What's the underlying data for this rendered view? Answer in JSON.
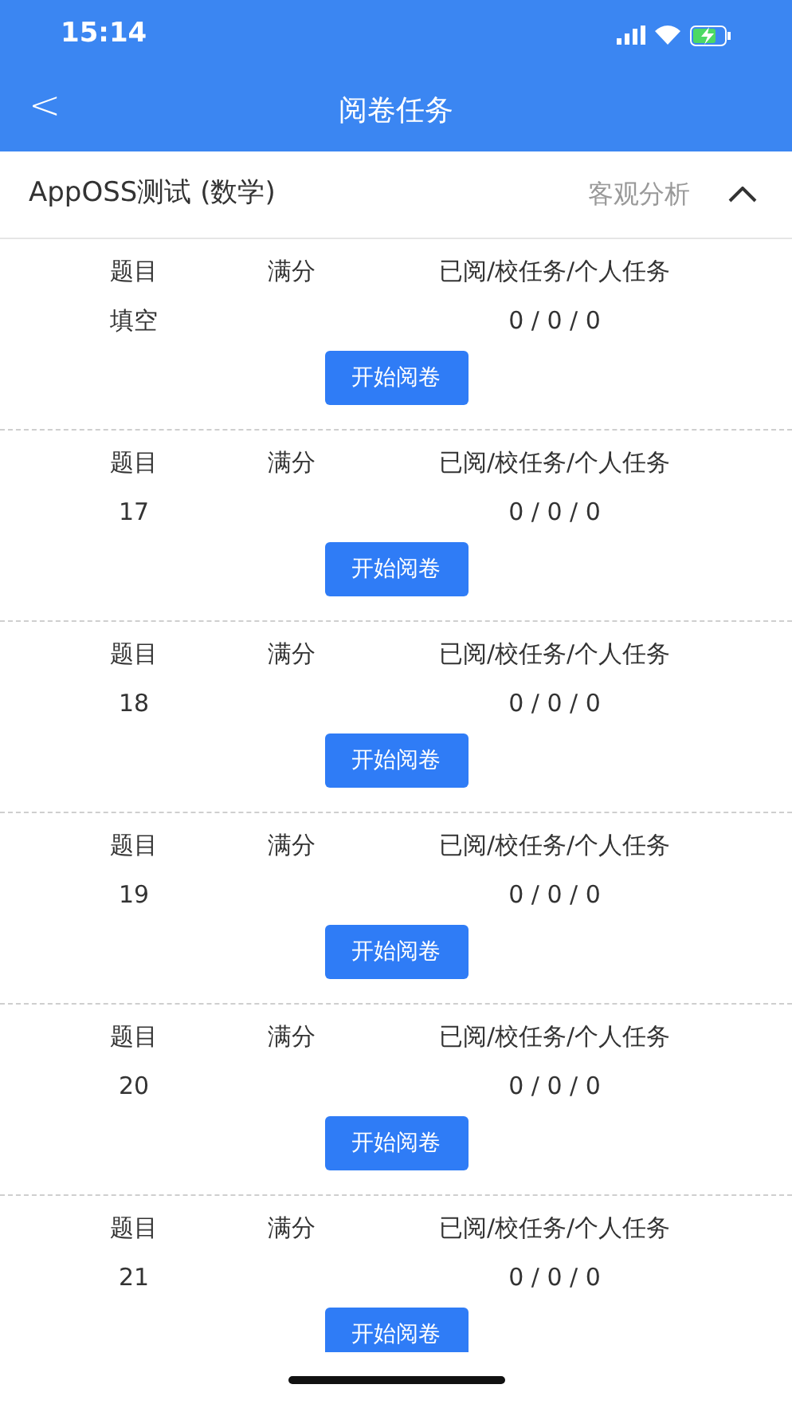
{
  "status_bar": {
    "time": "15:14"
  },
  "header": {
    "back": "<",
    "title": "阅卷任务"
  },
  "exam": {
    "name": "AppOSS测试 (数学)",
    "analysis": "客观分析",
    "expanded": true
  },
  "tasks": [
    {
      "labels": [
        "题目",
        "满分",
        "已阅/校任务/个人任务"
      ],
      "question": "填空",
      "progress": "0 / 0 / 0",
      "button": "开始阅卷"
    },
    {
      "labels": [
        "题目",
        "满分",
        "已阅/校任务/个人任务"
      ],
      "question": "17",
      "progress": "0 / 0 / 0",
      "button": "开始阅卷"
    },
    {
      "labels": [
        "题目",
        "满分",
        "已阅/校任务/个人任务"
      ],
      "question": "18",
      "progress": "0 / 0 / 0",
      "button": "开始阅卷"
    },
    {
      "labels": [
        "题目",
        "满分",
        "已阅/校任务/个人任务"
      ],
      "question": "19",
      "progress": "0 / 0 / 0",
      "button": "开始阅卷"
    },
    {
      "labels": [
        "题目",
        "满分",
        "已阅/校任务/个人任务"
      ],
      "question": "20",
      "progress": "0 / 0 / 0",
      "button": "开始阅卷"
    },
    {
      "labels": [
        "题目",
        "满分",
        "已阅/校任务/个人任务"
      ],
      "question": "21",
      "progress": "0 / 0 / 0",
      "button": "开始阅卷"
    }
  ]
}
